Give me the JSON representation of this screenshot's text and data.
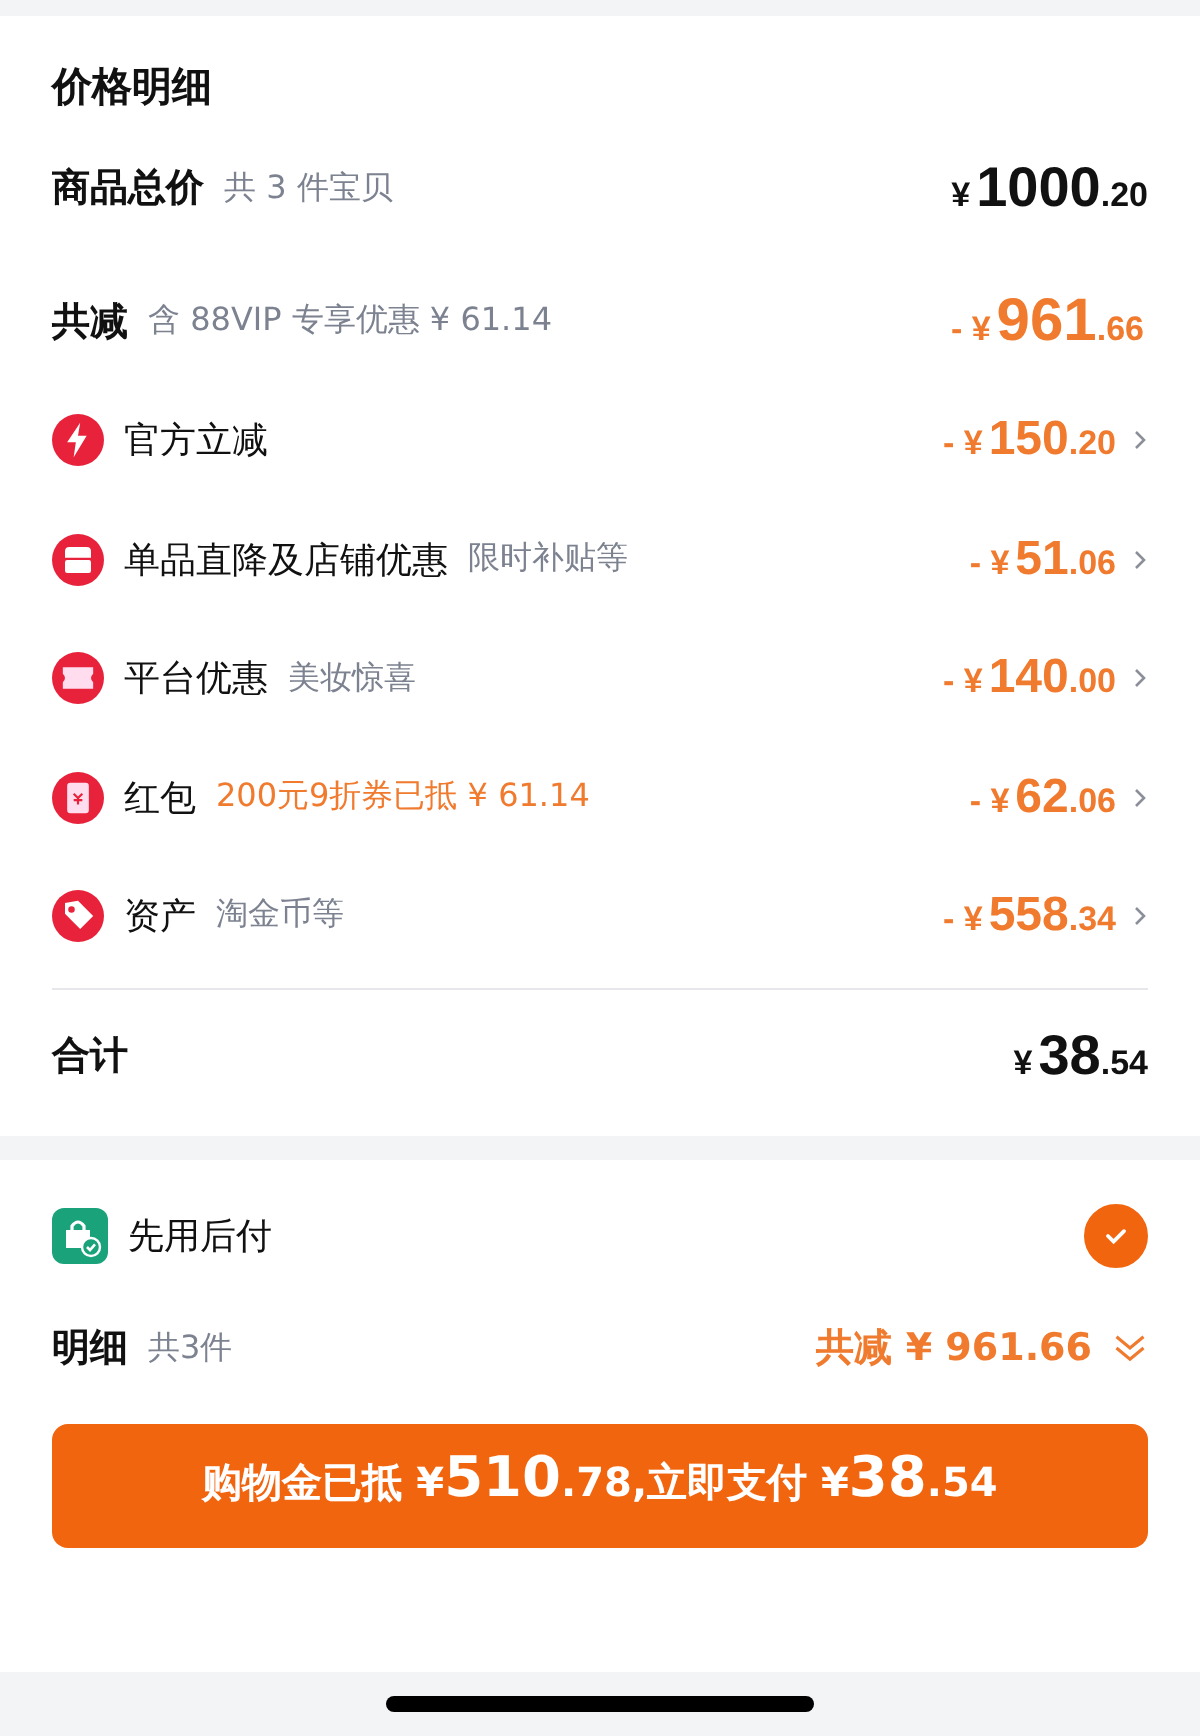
{
  "price_detail": {
    "title": "价格明细",
    "total": {
      "label": "商品总价",
      "note": "共 3 件宝贝",
      "amount": {
        "prefix": "¥",
        "int": "1000",
        "dec": ".20"
      }
    },
    "reduction": {
      "label": "共减",
      "note": "含 88VIP 专享优惠 ¥ 61.14",
      "amount": {
        "prefix": "- ¥",
        "int": "961",
        "dec": ".66"
      }
    },
    "discounts": [
      {
        "kind": "bolt",
        "label": "官方立减",
        "amount": {
          "prefix": "- ¥",
          "int": "150",
          "dec": ".20"
        }
      },
      {
        "kind": "store",
        "label": "单品直降及店铺优惠",
        "note": "限时补贴等",
        "note_highlighted": false,
        "amount": {
          "prefix": "- ¥",
          "int": "51",
          "dec": ".06"
        }
      },
      {
        "kind": "ticket",
        "label": "平台优惠",
        "note": "美妆惊喜",
        "note_highlighted": false,
        "amount": {
          "prefix": "- ¥",
          "int": "140",
          "dec": ".00"
        }
      },
      {
        "kind": "packet",
        "label": "红包",
        "note": "200元9折券已抵 ¥ 61.14",
        "note_highlighted": true,
        "amount": {
          "prefix": "- ¥",
          "int": "62",
          "dec": ".06"
        }
      },
      {
        "kind": "tag",
        "label": "资产",
        "note": "淘金币等",
        "note_highlighted": false,
        "amount": {
          "prefix": "- ¥",
          "int": "558",
          "dec": ".34"
        }
      }
    ],
    "sum": {
      "label": "合计",
      "amount": {
        "prefix": "¥",
        "int": "38",
        "dec": ".54"
      }
    }
  },
  "pay_later": {
    "label": "先用后付",
    "checked": true
  },
  "detail": {
    "label": "明细",
    "note": "共3件",
    "reduction": "共减 ¥ 961.66"
  },
  "pay_button": [
    {
      "kind": "label",
      "text": "购物金已抵 ¥ "
    },
    {
      "kind": "big",
      "text": "510"
    },
    {
      "kind": "small",
      "text": ".78,立即支付 ¥ "
    },
    {
      "kind": "big",
      "text": "38"
    },
    {
      "kind": "small",
      "text": ".54"
    }
  ]
}
